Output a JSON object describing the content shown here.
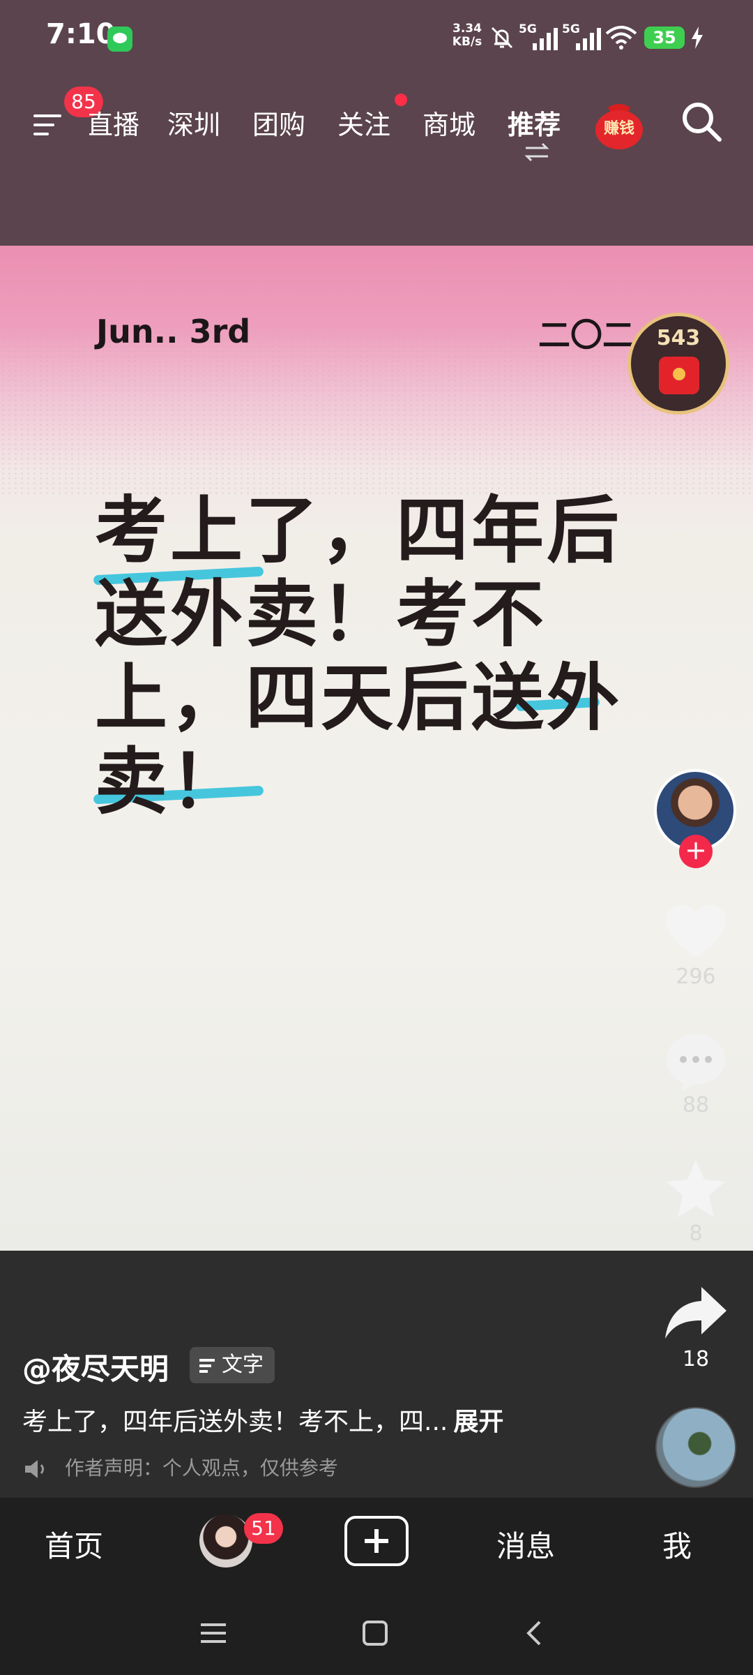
{
  "status_bar": {
    "time": "7:10",
    "net_speed_value": "3.34",
    "net_speed_unit": "KB/s",
    "sim1_type": "5G",
    "sim2_type": "5G",
    "battery_level": "35",
    "icons": [
      "message-app-icon",
      "bell-muted-icon",
      "signal-icon",
      "signal-icon",
      "wifi-icon",
      "battery-icon",
      "charging-icon"
    ]
  },
  "top_nav": {
    "menu_badge": "85",
    "tabs": [
      {
        "label": "直播"
      },
      {
        "label": "深圳"
      },
      {
        "label": "团购"
      },
      {
        "label": "关注"
      },
      {
        "label": "商城"
      },
      {
        "label": "推荐"
      }
    ],
    "earn_label": "赚钱"
  },
  "video": {
    "date_en": "Jun.. 3rd",
    "date_cn": "二〇二",
    "redpack_count": "543",
    "main_text": "考上了，四年后送外卖！考不上，四天后送外卖！"
  },
  "actions": {
    "likes": "296",
    "comments": "88",
    "favorites": "8",
    "shares": "18"
  },
  "info": {
    "author": "@夜尽天明",
    "tag": "文字",
    "caption": "考上了，四年后送外卖！考不上，四...",
    "expand": "展开",
    "declaration": "作者声明：个人观点，仅供参考"
  },
  "bottom_tabs": {
    "home": "首页",
    "friends_badge": "51",
    "messages": "消息",
    "me": "我"
  },
  "colors": {
    "accent_red": "#f2334a",
    "highlight_blue": "#45c6dd",
    "top_bg": "#5b444d",
    "video_pink": "#eb8fb1"
  }
}
